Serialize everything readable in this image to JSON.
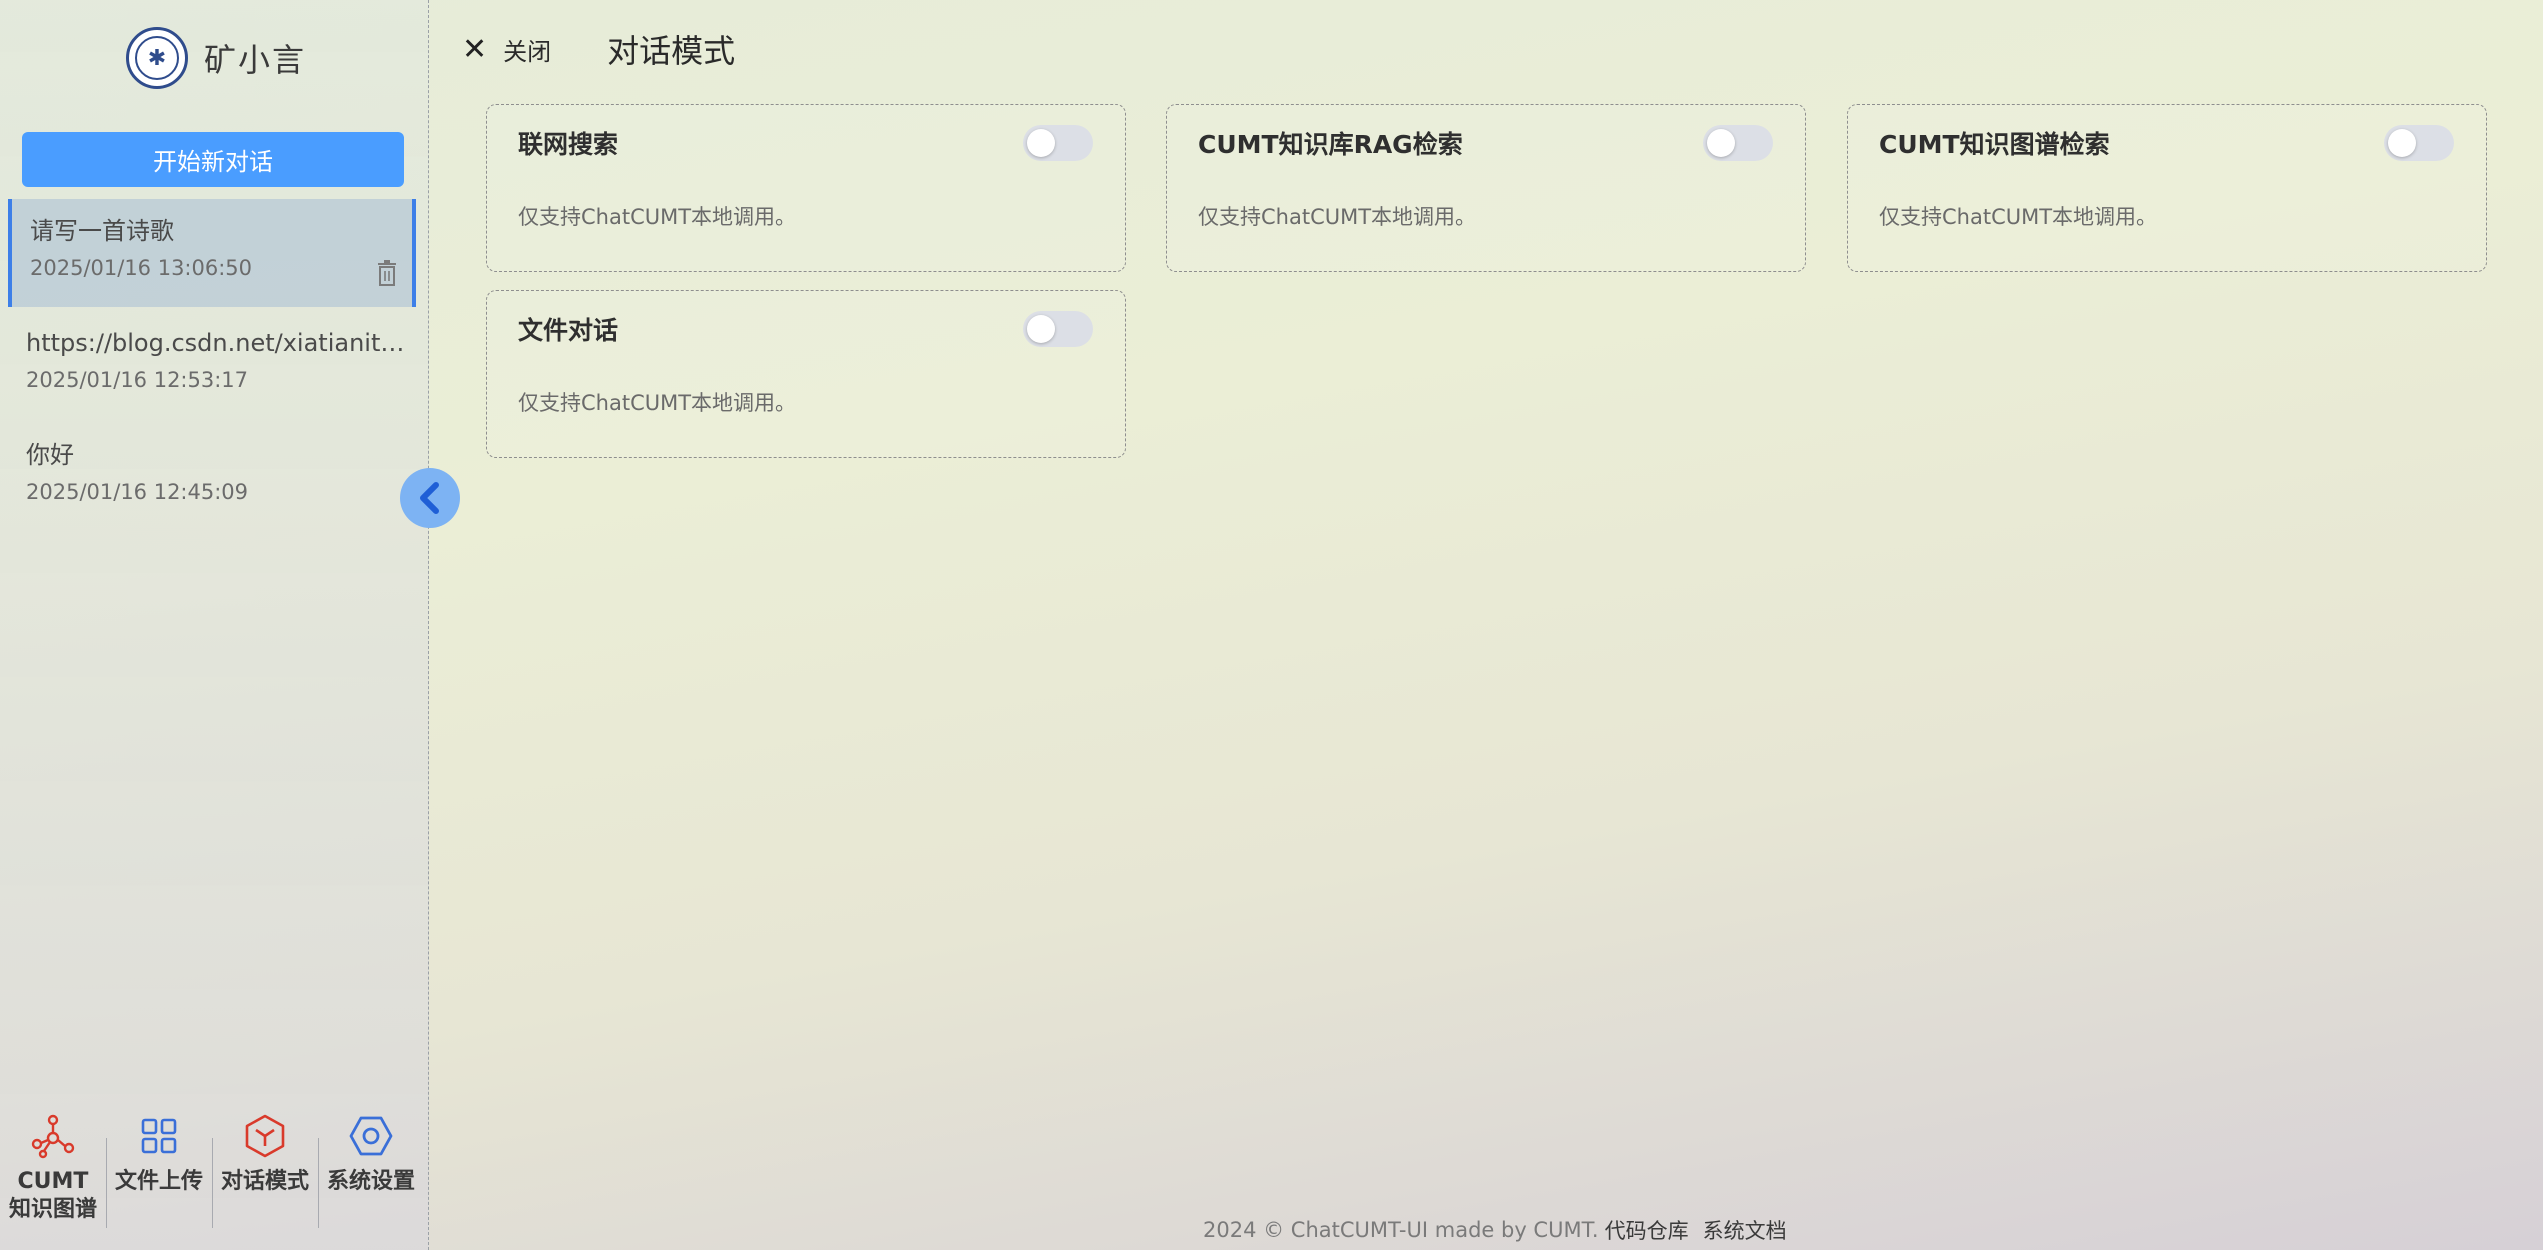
{
  "sidebar": {
    "brand": {
      "name": "矿小言",
      "logo_icon": "university-seal-icon"
    },
    "new_chat_label": "开始新对话",
    "conversations": [
      {
        "title": "请写一首诗歌",
        "time": "2025/01/16 13:06:50",
        "active": true
      },
      {
        "title": "https://blog.csdn.net/xiatianit/article/details/...",
        "time": "2025/01/16 12:53:17",
        "active": false
      },
      {
        "title": "你好",
        "time": "2025/01/16 12:45:09",
        "active": false
      }
    ],
    "toggle_icon": "chevron-left-icon",
    "bottom_nav": [
      {
        "label": "CUMT\n知识图谱",
        "icon": "graph-network-icon",
        "color": "#d93a2b"
      },
      {
        "label": "文件上传",
        "icon": "grid-icon",
        "color": "#3a6fd8"
      },
      {
        "label": "对话模式",
        "icon": "cube-hexagon-icon",
        "color": "#d93a2b"
      },
      {
        "label": "系统设置",
        "icon": "hexagon-settings-icon",
        "color": "#3a6fd8"
      }
    ]
  },
  "topbar": {
    "close_label": "关闭",
    "title": "对话模式"
  },
  "modes": [
    {
      "title": "联网搜索",
      "desc": "仅支持ChatCUMT本地调用。",
      "enabled": false
    },
    {
      "title": "CUMT知识库RAG检索",
      "desc": "仅支持ChatCUMT本地调用。",
      "enabled": false
    },
    {
      "title": "CUMT知识图谱检索",
      "desc": "仅支持ChatCUMT本地调用。",
      "enabled": false
    },
    {
      "title": "文件对话",
      "desc": "仅支持ChatCUMT本地调用。",
      "enabled": false
    }
  ],
  "footer": {
    "text": "2024 © ChatCUMT-UI made by CUMT.",
    "link_repo": "代码仓库",
    "link_docs": "系统文档"
  },
  "colors": {
    "accent": "#4a9dff",
    "active_border": "#3d7fe8",
    "icon_red": "#d93a2b",
    "icon_blue": "#3a6fd8"
  }
}
